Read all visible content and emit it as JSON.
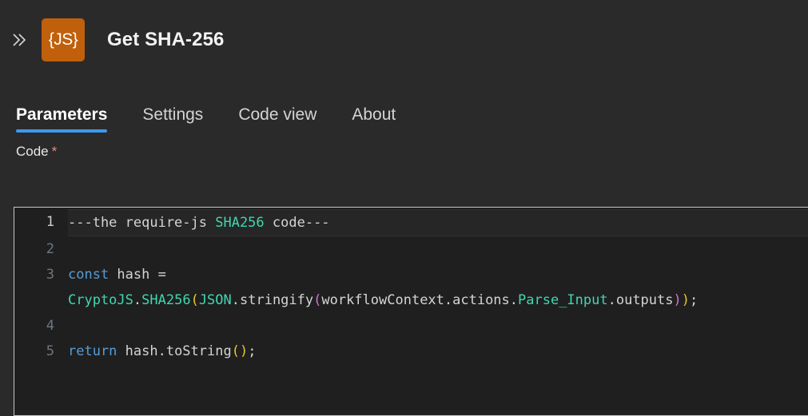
{
  "header": {
    "collapse_icon": "double-chevron-right-icon",
    "node_icon_label": "{JS}",
    "node_icon_color": "#c0600d",
    "title": "Get SHA-256"
  },
  "tabs": {
    "active_index": 0,
    "accent_color": "#3b99ef",
    "items": [
      {
        "label": "Parameters"
      },
      {
        "label": "Settings"
      },
      {
        "label": "Code view"
      },
      {
        "label": "About"
      }
    ]
  },
  "field": {
    "label": "Code",
    "required_marker": "*",
    "required": true
  },
  "editor": {
    "background": "#1f1f1f",
    "border_color": "#c8c8c8",
    "active_line": 1,
    "lines": [
      {
        "number": "1",
        "active": true,
        "tokens": [
          {
            "text": "---the require-js ",
            "style": "plain"
          },
          {
            "text": "SHA256",
            "style": "type"
          },
          {
            "text": " code---",
            "style": "plain"
          }
        ]
      },
      {
        "number": "2",
        "active": false,
        "tokens": []
      },
      {
        "number": "3",
        "active": false,
        "tokens": [
          {
            "text": "const",
            "style": "key"
          },
          {
            "text": " hash = ",
            "style": "plain"
          },
          {
            "text": "CryptoJS",
            "style": "type"
          },
          {
            "text": ".",
            "style": "plain"
          },
          {
            "text": "SHA256",
            "style": "type"
          },
          {
            "text": "(",
            "style": "paren-yellow"
          },
          {
            "text": "JSON",
            "style": "type"
          },
          {
            "text": ".stringify",
            "style": "plain"
          },
          {
            "text": "(",
            "style": "paren-magenta"
          },
          {
            "text": "workflowContext.actions.",
            "style": "plain"
          },
          {
            "text": "Parse_Input",
            "style": "type"
          },
          {
            "text": ".outputs",
            "style": "plain"
          },
          {
            "text": ")",
            "style": "paren-magenta"
          },
          {
            "text": ")",
            "style": "paren-yellow"
          },
          {
            "text": ";",
            "style": "plain"
          }
        ]
      },
      {
        "number": "4",
        "active": false,
        "tokens": []
      },
      {
        "number": "5",
        "active": false,
        "tokens": [
          {
            "text": "return",
            "style": "key"
          },
          {
            "text": " hash.toString",
            "style": "plain"
          },
          {
            "text": "()",
            "style": "paren-yellow"
          },
          {
            "text": ";",
            "style": "plain"
          }
        ]
      }
    ]
  }
}
